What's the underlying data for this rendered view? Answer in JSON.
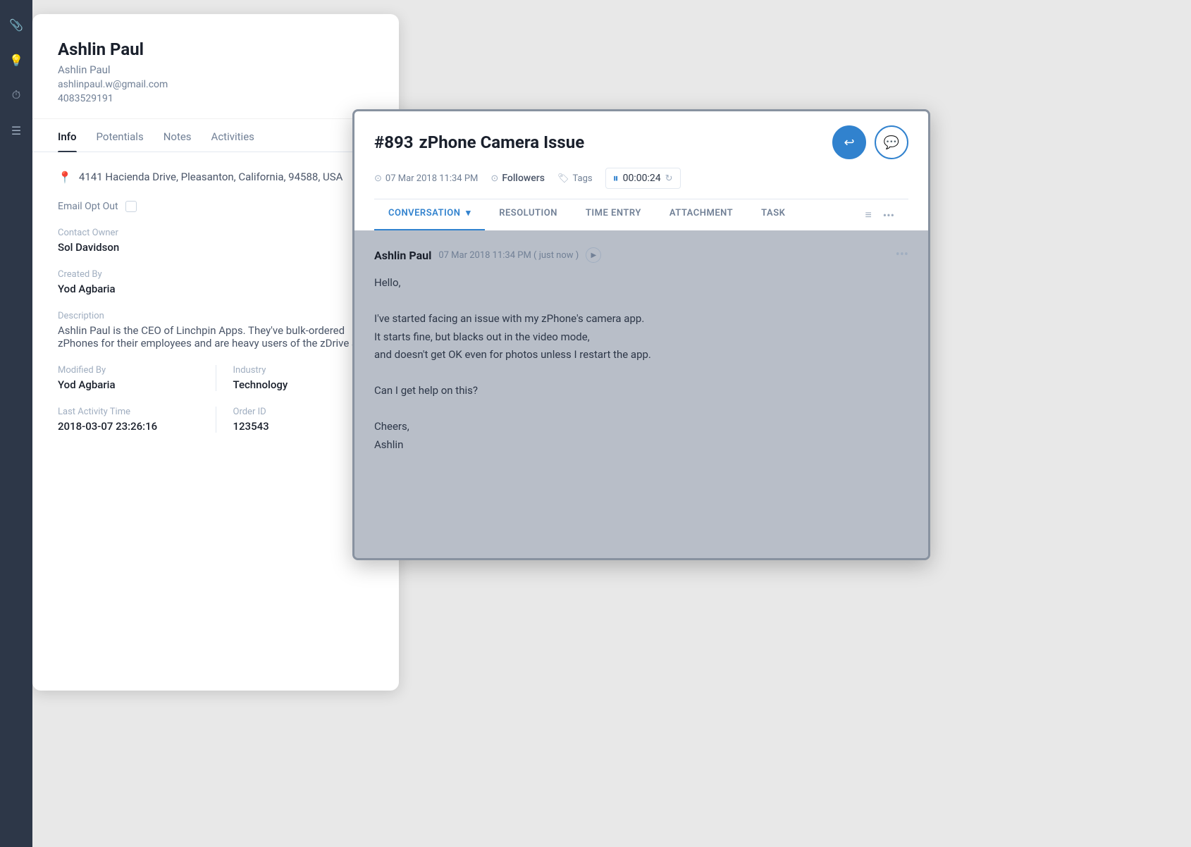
{
  "sidebar": {
    "icons": [
      {
        "name": "paperclip-icon",
        "symbol": "📎"
      },
      {
        "name": "lightbulb-icon",
        "symbol": "💡"
      },
      {
        "name": "history-icon",
        "symbol": "⏱"
      },
      {
        "name": "menu-icon",
        "symbol": "☰"
      }
    ]
  },
  "contact": {
    "name_main": "Ashlin Paul",
    "name_sub": "Ashlin Paul",
    "email": "ashlinpaul.w@gmail.com",
    "phone": "4083529191",
    "tabs": [
      {
        "label": "Info",
        "active": true
      },
      {
        "label": "Potentials",
        "active": false
      },
      {
        "label": "Notes",
        "active": false
      },
      {
        "label": "Activities",
        "active": false
      }
    ],
    "address": "4141 Hacienda Drive, Pleasanton, California, 94588, USA",
    "email_opt_out_label": "Email Opt Out",
    "contact_owner_label": "Contact Owner",
    "contact_owner": "Sol Davidson",
    "created_by_label": "Created By",
    "created_by": "Yod Agbaria",
    "description_label": "Description",
    "description": "Ashlin Paul is the CEO of Linchpin Apps. They've bulk-ordered zPhones for their employees and are heavy users of the zDrive app.",
    "modified_by_label": "Modified By",
    "modified_by": "Yod Agbaria",
    "industry_label": "Industry",
    "industry": "Technology",
    "last_activity_label": "Last Activity Time",
    "last_activity": "2018-03-07 23:26:16",
    "order_id_label": "Order ID",
    "order_id": "123543"
  },
  "ticket": {
    "id": "#893",
    "title": "zPhone Camera Issue",
    "meta_date": "07 Mar 2018 11:34 PM",
    "followers_label": "Followers",
    "tags_label": "Tags",
    "timer": "00:00:24",
    "tabs": [
      {
        "label": "CONVERSATION",
        "active": true
      },
      {
        "label": "RESOLUTION",
        "active": false
      },
      {
        "label": "TIME ENTRY",
        "active": false
      },
      {
        "label": "ATTACHMENT",
        "active": false
      },
      {
        "label": "TASK",
        "active": false
      }
    ],
    "message": {
      "author": "Ashlin Paul",
      "time": "07 Mar 2018 11:34 PM ( just now )",
      "greeting": "Hello,",
      "line1": "I've started facing an issue with my zPhone's camera app.",
      "line2": "It starts fine, but blacks out in the video mode,",
      "line3": "and doesn't get OK even for photos unless I restart the app.",
      "line4": "",
      "line5": "Can I get help on this?",
      "line6": "",
      "line7": "Cheers,",
      "line8": "Ashlin"
    }
  }
}
